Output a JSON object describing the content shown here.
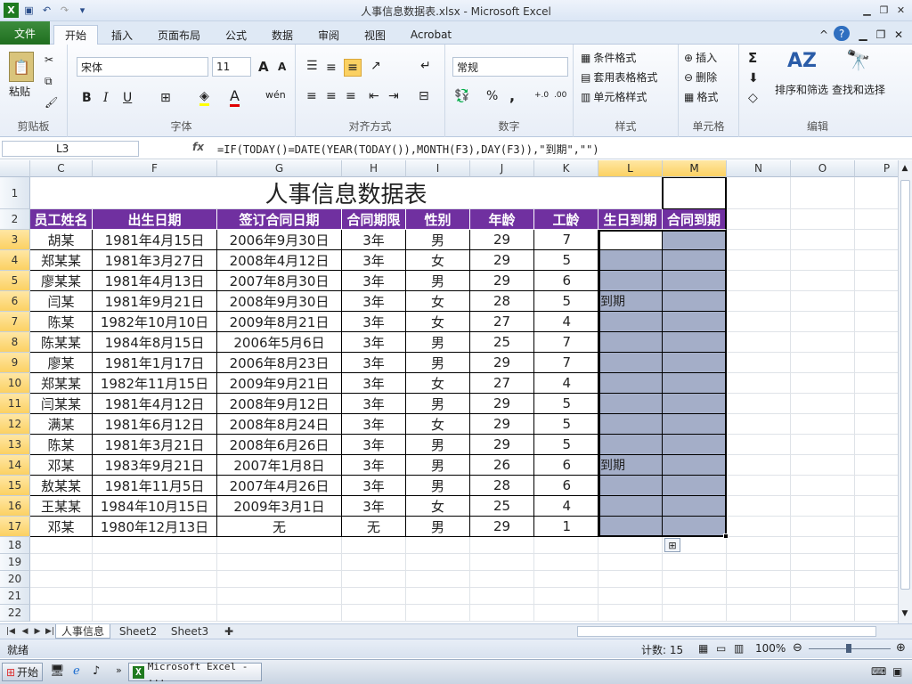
{
  "window": {
    "title": "人事信息数据表.xlsx - Microsoft Excel"
  },
  "tabs": {
    "file": "文件",
    "items": [
      "开始",
      "插入",
      "页面布局",
      "公式",
      "数据",
      "审阅",
      "视图",
      "Acrobat"
    ]
  },
  "ribbon": {
    "clipboard": {
      "paste": "粘贴",
      "label": "剪贴板"
    },
    "font": {
      "name": "宋体",
      "size": "11",
      "bold": "B",
      "italic": "I",
      "underline": "U",
      "label": "字体",
      "grow": "A",
      "shrink": "A",
      "color_a": "A",
      "wen": "wén"
    },
    "align": {
      "label": "对齐方式"
    },
    "number": {
      "format": "常规",
      "percent": "%",
      "comma": ",",
      "label": "数字",
      "inc": "+.0 .00",
      "dec": ".00 →.0"
    },
    "styles": {
      "conditional": "条件格式",
      "table": "套用表格格式",
      "cell": "单元格样式",
      "label": "样式"
    },
    "cells": {
      "insert": "插入",
      "delete": "删除",
      "format": "格式",
      "label": "单元格"
    },
    "editing": {
      "sum": "Σ",
      "sort": "排序和筛选",
      "find": "查找和选择",
      "label": "编辑"
    }
  },
  "formula_bar": {
    "name_box": "L3",
    "fx": "fx",
    "formula": "=IF(TODAY()=DATE(YEAR(TODAY()),MONTH(F3),DAY(F3)),\"到期\",\"\")"
  },
  "columns": [
    "C",
    "F",
    "G",
    "H",
    "I",
    "J",
    "K",
    "L",
    "M",
    "N",
    "O",
    "P"
  ],
  "rows": [
    "1",
    "2",
    "3",
    "4",
    "5",
    "6",
    "7",
    "8",
    "9",
    "10",
    "11",
    "12",
    "13",
    "14",
    "15",
    "16",
    "17",
    "18",
    "19",
    "20",
    "21",
    "22"
  ],
  "sheet": {
    "title": "人事信息数据表",
    "headers": [
      "员工姓名",
      "出生日期",
      "签订合同日期",
      "合同期限",
      "性别",
      "年龄",
      "工龄",
      "生日到期",
      "合同到期"
    ],
    "data": [
      [
        "胡某",
        "1981年4月15日",
        "2006年9月30日",
        "3年",
        "男",
        "29",
        "7",
        "",
        ""
      ],
      [
        "郑某某",
        "1981年3月27日",
        "2008年4月12日",
        "3年",
        "女",
        "29",
        "5",
        "",
        ""
      ],
      [
        "廖某某",
        "1981年4月13日",
        "2007年8月30日",
        "3年",
        "男",
        "29",
        "6",
        "",
        ""
      ],
      [
        "闫某",
        "1981年9月21日",
        "2008年9月30日",
        "3年",
        "女",
        "28",
        "5",
        "到期",
        ""
      ],
      [
        "陈某",
        "1982年10月10日",
        "2009年8月21日",
        "3年",
        "女",
        "27",
        "4",
        "",
        ""
      ],
      [
        "陈某某",
        "1984年8月15日",
        "2006年5月6日",
        "3年",
        "男",
        "25",
        "7",
        "",
        ""
      ],
      [
        "廖某",
        "1981年1月17日",
        "2006年8月23日",
        "3年",
        "男",
        "29",
        "7",
        "",
        ""
      ],
      [
        "郑某某",
        "1982年11月15日",
        "2009年9月21日",
        "3年",
        "女",
        "27",
        "4",
        "",
        ""
      ],
      [
        "闫某某",
        "1981年4月12日",
        "2008年9月12日",
        "3年",
        "男",
        "29",
        "5",
        "",
        ""
      ],
      [
        "满某",
        "1981年6月12日",
        "2008年8月24日",
        "3年",
        "女",
        "29",
        "5",
        "",
        ""
      ],
      [
        "陈某",
        "1981年3月21日",
        "2008年6月26日",
        "3年",
        "男",
        "29",
        "5",
        "",
        ""
      ],
      [
        "邓某",
        "1983年9月21日",
        "2007年1月8日",
        "3年",
        "男",
        "26",
        "6",
        "到期",
        ""
      ],
      [
        "敖某某",
        "1981年11月5日",
        "2007年4月26日",
        "3年",
        "男",
        "28",
        "6",
        "",
        ""
      ],
      [
        "王某某",
        "1984年10月15日",
        "2009年3月1日",
        "3年",
        "女",
        "25",
        "4",
        "",
        ""
      ],
      [
        "邓某",
        "1980年12月13日",
        "无",
        "无",
        "男",
        "29",
        "1",
        "",
        ""
      ]
    ]
  },
  "sheet_tabs": [
    "人事信息",
    "Sheet2",
    "Sheet3"
  ],
  "status": {
    "ready": "就绪",
    "count": "计数: 15",
    "zoom": "100%"
  },
  "taskbar": {
    "start": "开始",
    "app": "Microsoft Excel - ..."
  }
}
